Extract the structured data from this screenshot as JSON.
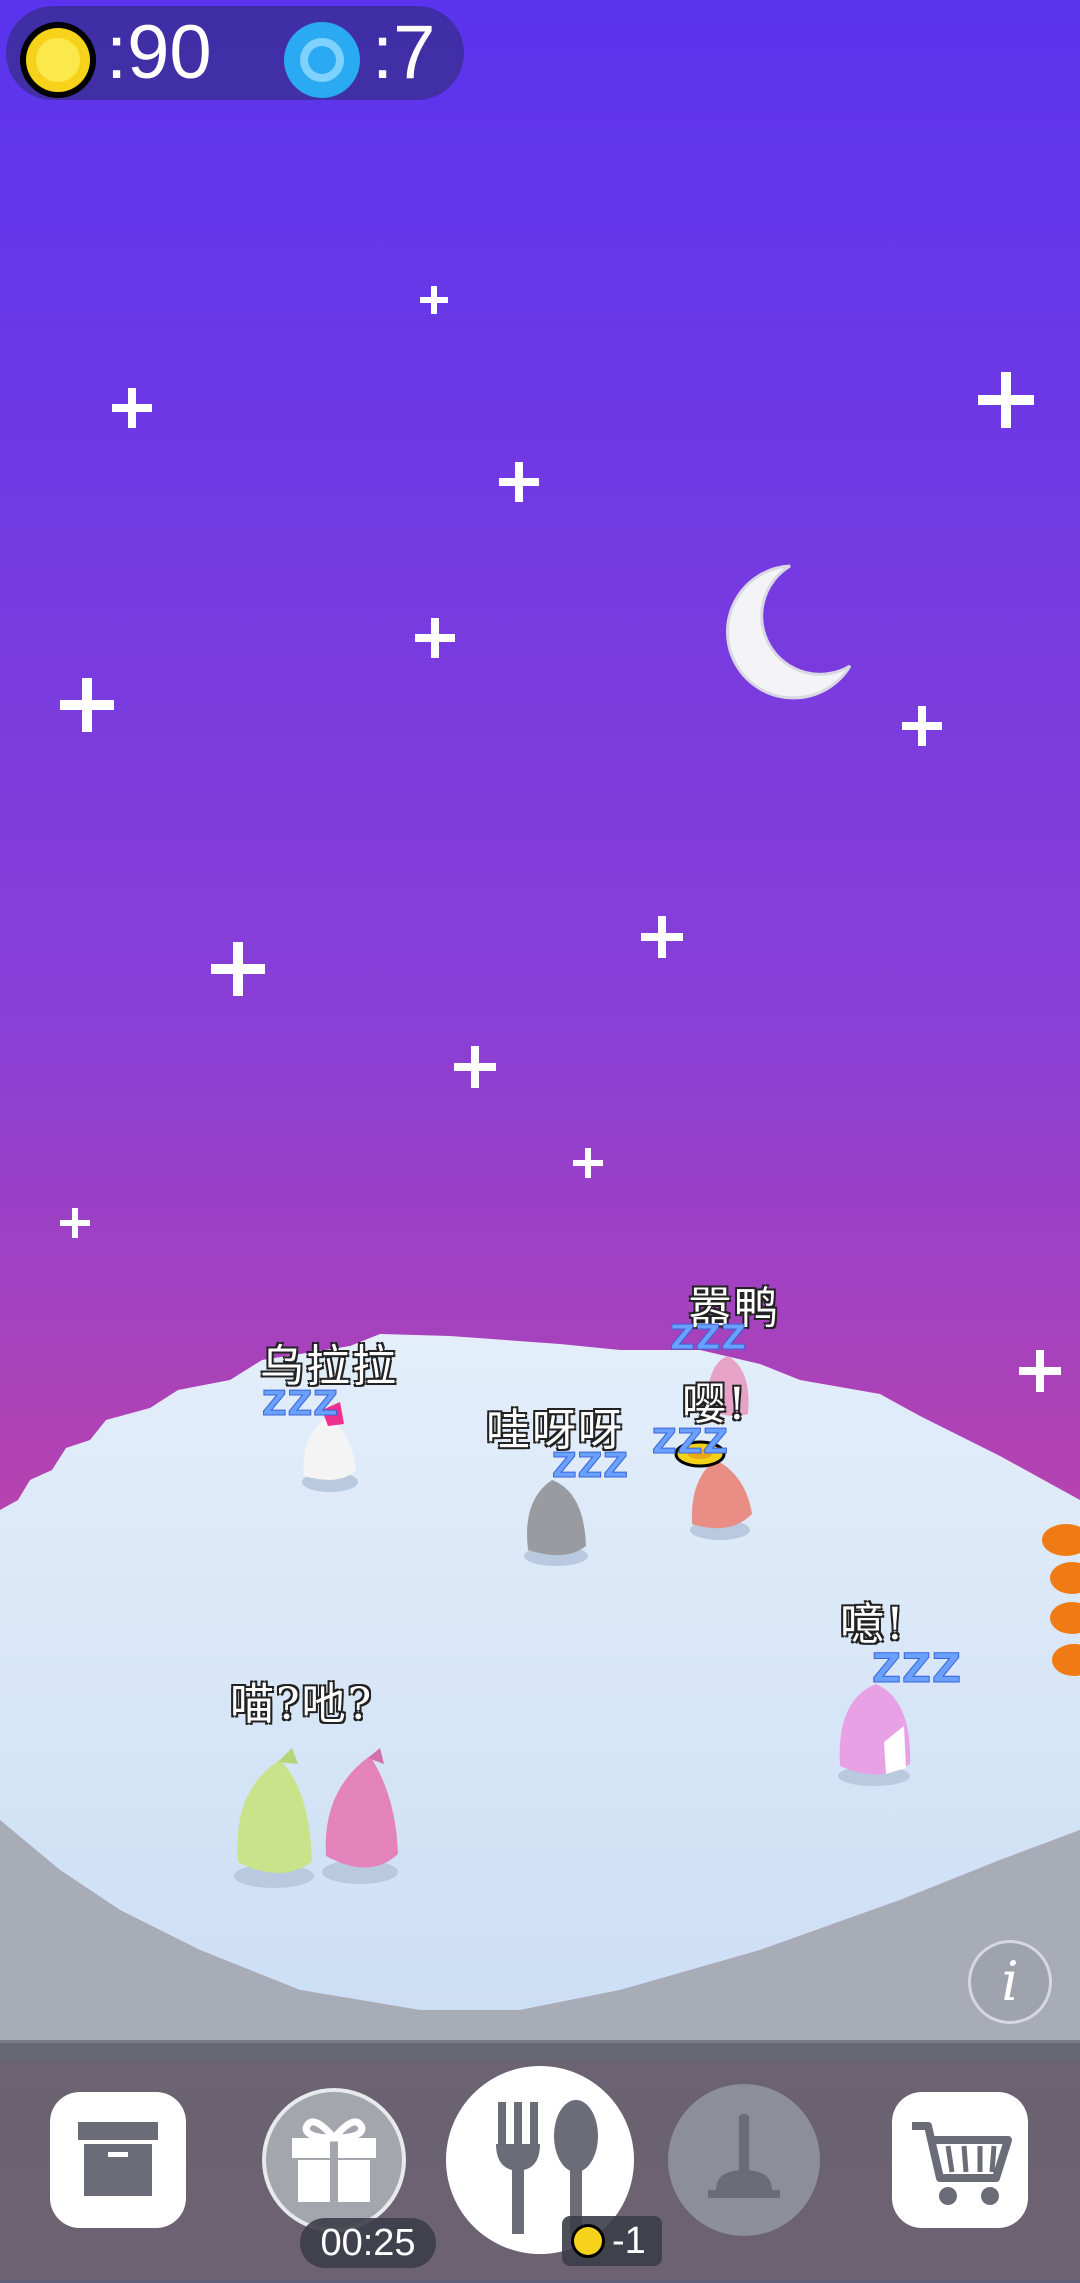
{
  "hud": {
    "coins_label": ":90",
    "gems_label": ":7"
  },
  "pets": [
    {
      "name": "乌拉拉",
      "status": "ZZZ",
      "color": "#f2f2f2"
    },
    {
      "name": "哇呀呀",
      "status": "ZZZ",
      "color": "#9a9ca0"
    },
    {
      "name": "嚣鸭",
      "status": "ZZZ",
      "color": "#e7a3c6"
    },
    {
      "name": "嘤!",
      "status": "ZZZ",
      "color": "#e88e84"
    },
    {
      "name": "喵?吔?",
      "status": "",
      "color": "#c8e38a"
    },
    {
      "name": "噫!",
      "status": "ZZZ",
      "color": "#e9a1e6"
    }
  ],
  "bottom_bar": {
    "storage_icon": "archive-box-icon",
    "gift_icon": "gift-icon",
    "gift_timer": "00:25",
    "feed_icon": "fork-spoon-icon",
    "feed_cost": "-1",
    "clean_icon": "plunger-icon",
    "shop_icon": "cart-icon"
  },
  "info_icon": "info-icon",
  "colors": {
    "sky_top": "#5a34ee",
    "sky_bottom": "#d94a86",
    "floor": "#dbe8f8",
    "bar": "#626470",
    "coin": "#f6d31a",
    "gem": "#29aaf2"
  }
}
